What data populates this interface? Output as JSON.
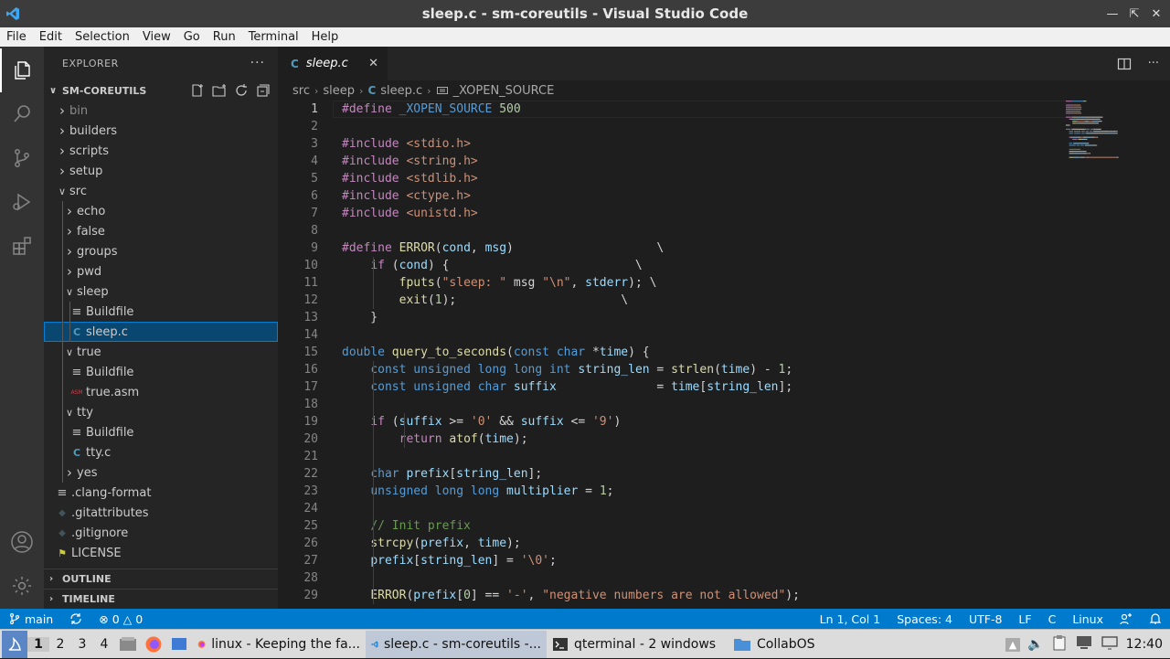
{
  "window": {
    "title": "sleep.c - sm-coreutils - Visual Studio Code"
  },
  "menu": [
    "File",
    "Edit",
    "Selection",
    "View",
    "Go",
    "Run",
    "Terminal",
    "Help"
  ],
  "explorer": {
    "header": "EXPLORER",
    "workspace": "SM-COREUTILS",
    "items": [
      {
        "label": "bin",
        "kind": "folder",
        "open": false,
        "depth": 0,
        "dim": true
      },
      {
        "label": "builders",
        "kind": "folder",
        "open": false,
        "depth": 0
      },
      {
        "label": "scripts",
        "kind": "folder",
        "open": false,
        "depth": 0
      },
      {
        "label": "setup",
        "kind": "folder",
        "open": false,
        "depth": 0
      },
      {
        "label": "src",
        "kind": "folder",
        "open": true,
        "depth": 0
      },
      {
        "label": "echo",
        "kind": "folder",
        "open": false,
        "depth": 1
      },
      {
        "label": "false",
        "kind": "folder",
        "open": false,
        "depth": 1
      },
      {
        "label": "groups",
        "kind": "folder",
        "open": false,
        "depth": 1
      },
      {
        "label": "pwd",
        "kind": "folder",
        "open": false,
        "depth": 1
      },
      {
        "label": "sleep",
        "kind": "folder",
        "open": true,
        "depth": 1
      },
      {
        "label": "Buildfile",
        "kind": "build",
        "depth": 2
      },
      {
        "label": "sleep.c",
        "kind": "c",
        "depth": 2,
        "selected": true
      },
      {
        "label": "true",
        "kind": "folder",
        "open": true,
        "depth": 1
      },
      {
        "label": "Buildfile",
        "kind": "build",
        "depth": 2
      },
      {
        "label": "true.asm",
        "kind": "asm",
        "depth": 2
      },
      {
        "label": "tty",
        "kind": "folder",
        "open": true,
        "depth": 1
      },
      {
        "label": "Buildfile",
        "kind": "build",
        "depth": 2
      },
      {
        "label": "tty.c",
        "kind": "c",
        "depth": 2
      },
      {
        "label": "yes",
        "kind": "folder",
        "open": false,
        "depth": 1
      },
      {
        "label": ".clang-format",
        "kind": "build",
        "depth": 0
      },
      {
        "label": ".gitattributes",
        "kind": "git",
        "depth": 0
      },
      {
        "label": ".gitignore",
        "kind": "git",
        "depth": 0
      },
      {
        "label": "LICENSE",
        "kind": "license",
        "depth": 0
      }
    ],
    "outline": "OUTLINE",
    "timeline": "TIMELINE"
  },
  "editor": {
    "tab": "sleep.c",
    "tab_icon": "C",
    "breadcrumb": [
      "src",
      "sleep",
      "sleep.c",
      "_XOPEN_SOURCE"
    ],
    "current_line": 1,
    "lines": [
      [
        [
          "#define ",
          "#c586c0"
        ],
        [
          "_XOPEN_SOURCE",
          "#569cd6"
        ],
        [
          " 500",
          "#b5cea8"
        ]
      ],
      [],
      [
        [
          "#include ",
          "#c586c0"
        ],
        [
          "<stdio.h>",
          "#ce9178"
        ]
      ],
      [
        [
          "#include ",
          "#c586c0"
        ],
        [
          "<string.h>",
          "#ce9178"
        ]
      ],
      [
        [
          "#include ",
          "#c586c0"
        ],
        [
          "<stdlib.h>",
          "#ce9178"
        ]
      ],
      [
        [
          "#include ",
          "#c586c0"
        ],
        [
          "<ctype.h>",
          "#ce9178"
        ]
      ],
      [
        [
          "#include ",
          "#c586c0"
        ],
        [
          "<unistd.h>",
          "#ce9178"
        ]
      ],
      [],
      [
        [
          "#define ",
          "#c586c0"
        ],
        [
          "ERROR",
          "#dcdcaa"
        ],
        [
          "(",
          "#d4d4d4"
        ],
        [
          "cond",
          "#9cdcfe"
        ],
        [
          ", ",
          "#d4d4d4"
        ],
        [
          "msg",
          "#9cdcfe"
        ],
        [
          ")                    \\",
          "#d4d4d4"
        ]
      ],
      [
        [
          "    ",
          "#d4d4d4"
        ],
        [
          "if",
          "#c586c0"
        ],
        [
          " (",
          "#d4d4d4"
        ],
        [
          "cond",
          "#9cdcfe"
        ],
        [
          ") {",
          "#d4d4d4"
        ],
        [
          "                          \\",
          "#d4d4d4"
        ]
      ],
      [
        [
          "        ",
          "#d4d4d4"
        ],
        [
          "fputs",
          "#dcdcaa"
        ],
        [
          "(",
          "#d4d4d4"
        ],
        [
          "\"sleep: \"",
          "#ce9178"
        ],
        [
          " msg ",
          "#d4d4d4"
        ],
        [
          "\"\\n\"",
          "#ce9178"
        ],
        [
          ", ",
          "#d4d4d4"
        ],
        [
          "stderr",
          "#9cdcfe"
        ],
        [
          "); \\",
          "#d4d4d4"
        ]
      ],
      [
        [
          "        ",
          "#d4d4d4"
        ],
        [
          "exit",
          "#dcdcaa"
        ],
        [
          "(",
          "#d4d4d4"
        ],
        [
          "1",
          "#b5cea8"
        ],
        [
          ");",
          "#d4d4d4"
        ],
        [
          "                       \\",
          "#d4d4d4"
        ]
      ],
      [
        [
          "    }",
          "#d4d4d4"
        ]
      ],
      [],
      [
        [
          "double",
          "#569cd6"
        ],
        [
          " ",
          "#d4d4d4"
        ],
        [
          "query_to_seconds",
          "#dcdcaa"
        ],
        [
          "(",
          "#d4d4d4"
        ],
        [
          "const",
          "#569cd6"
        ],
        [
          " ",
          "#d4d4d4"
        ],
        [
          "char",
          "#569cd6"
        ],
        [
          " *",
          "#d4d4d4"
        ],
        [
          "time",
          "#9cdcfe"
        ],
        [
          ") {",
          "#d4d4d4"
        ]
      ],
      [
        [
          "    ",
          "#d4d4d4"
        ],
        [
          "const",
          "#569cd6"
        ],
        [
          " ",
          "#d4d4d4"
        ],
        [
          "unsigned",
          "#569cd6"
        ],
        [
          " ",
          "#d4d4d4"
        ],
        [
          "long",
          "#569cd6"
        ],
        [
          " ",
          "#d4d4d4"
        ],
        [
          "long",
          "#569cd6"
        ],
        [
          " ",
          "#d4d4d4"
        ],
        [
          "int",
          "#569cd6"
        ],
        [
          " ",
          "#d4d4d4"
        ],
        [
          "string_len",
          "#9cdcfe"
        ],
        [
          " = ",
          "#d4d4d4"
        ],
        [
          "strlen",
          "#dcdcaa"
        ],
        [
          "(",
          "#d4d4d4"
        ],
        [
          "time",
          "#9cdcfe"
        ],
        [
          ") - ",
          "#d4d4d4"
        ],
        [
          "1",
          "#b5cea8"
        ],
        [
          ";",
          "#d4d4d4"
        ]
      ],
      [
        [
          "    ",
          "#d4d4d4"
        ],
        [
          "const",
          "#569cd6"
        ],
        [
          " ",
          "#d4d4d4"
        ],
        [
          "unsigned",
          "#569cd6"
        ],
        [
          " ",
          "#d4d4d4"
        ],
        [
          "char",
          "#569cd6"
        ],
        [
          " ",
          "#d4d4d4"
        ],
        [
          "suffix",
          "#9cdcfe"
        ],
        [
          "              = ",
          "#d4d4d4"
        ],
        [
          "time",
          "#9cdcfe"
        ],
        [
          "[",
          "#d4d4d4"
        ],
        [
          "string_len",
          "#9cdcfe"
        ],
        [
          "];",
          "#d4d4d4"
        ]
      ],
      [],
      [
        [
          "    ",
          "#d4d4d4"
        ],
        [
          "if",
          "#c586c0"
        ],
        [
          " (",
          "#d4d4d4"
        ],
        [
          "suffix",
          "#9cdcfe"
        ],
        [
          " >= ",
          "#d4d4d4"
        ],
        [
          "'0'",
          "#ce9178"
        ],
        [
          " && ",
          "#d4d4d4"
        ],
        [
          "suffix",
          "#9cdcfe"
        ],
        [
          " <= ",
          "#d4d4d4"
        ],
        [
          "'9'",
          "#ce9178"
        ],
        [
          ")",
          "#d4d4d4"
        ]
      ],
      [
        [
          "        ",
          "#d4d4d4"
        ],
        [
          "return",
          "#c586c0"
        ],
        [
          " ",
          "#d4d4d4"
        ],
        [
          "atof",
          "#dcdcaa"
        ],
        [
          "(",
          "#d4d4d4"
        ],
        [
          "time",
          "#9cdcfe"
        ],
        [
          ");",
          "#d4d4d4"
        ]
      ],
      [],
      [
        [
          "    ",
          "#d4d4d4"
        ],
        [
          "char",
          "#569cd6"
        ],
        [
          " ",
          "#d4d4d4"
        ],
        [
          "prefix",
          "#9cdcfe"
        ],
        [
          "[",
          "#d4d4d4"
        ],
        [
          "string_len",
          "#9cdcfe"
        ],
        [
          "];",
          "#d4d4d4"
        ]
      ],
      [
        [
          "    ",
          "#d4d4d4"
        ],
        [
          "unsigned",
          "#569cd6"
        ],
        [
          " ",
          "#d4d4d4"
        ],
        [
          "long",
          "#569cd6"
        ],
        [
          " ",
          "#d4d4d4"
        ],
        [
          "long",
          "#569cd6"
        ],
        [
          " ",
          "#d4d4d4"
        ],
        [
          "multiplier",
          "#9cdcfe"
        ],
        [
          " = ",
          "#d4d4d4"
        ],
        [
          "1",
          "#b5cea8"
        ],
        [
          ";",
          "#d4d4d4"
        ]
      ],
      [],
      [
        [
          "    ",
          "#d4d4d4"
        ],
        [
          "// Init prefix",
          "#6a9955"
        ]
      ],
      [
        [
          "    ",
          "#d4d4d4"
        ],
        [
          "strcpy",
          "#dcdcaa"
        ],
        [
          "(",
          "#d4d4d4"
        ],
        [
          "prefix",
          "#9cdcfe"
        ],
        [
          ", ",
          "#d4d4d4"
        ],
        [
          "time",
          "#9cdcfe"
        ],
        [
          ");",
          "#d4d4d4"
        ]
      ],
      [
        [
          "    ",
          "#d4d4d4"
        ],
        [
          "prefix",
          "#9cdcfe"
        ],
        [
          "[",
          "#d4d4d4"
        ],
        [
          "string_len",
          "#9cdcfe"
        ],
        [
          "] = ",
          "#d4d4d4"
        ],
        [
          "'\\0'",
          "#ce9178"
        ],
        [
          ";",
          "#d4d4d4"
        ]
      ],
      [],
      [
        [
          "    ",
          "#d4d4d4"
        ],
        [
          "ERROR",
          "#dcdcaa"
        ],
        [
          "(",
          "#d4d4d4"
        ],
        [
          "prefix",
          "#9cdcfe"
        ],
        [
          "[",
          "#d4d4d4"
        ],
        [
          "0",
          "#b5cea8"
        ],
        [
          "] == ",
          "#d4d4d4"
        ],
        [
          "'-'",
          "#ce9178"
        ],
        [
          ", ",
          "#d4d4d4"
        ],
        [
          "\"negative numbers are not allowed\"",
          "#ce9178"
        ],
        [
          ");",
          "#d4d4d4"
        ]
      ]
    ]
  },
  "status": {
    "branch": "main",
    "errors": "0",
    "warnings": "0",
    "position": "Ln 1, Col 1",
    "spaces": "Spaces: 4",
    "encoding": "UTF-8",
    "eol": "LF",
    "language": "C",
    "platform": "Linux"
  },
  "taskbar": {
    "workspaces": [
      "1",
      "2",
      "3",
      "4"
    ],
    "tasks": [
      {
        "label": "linux - Keeping the fa...",
        "icon": "firefox-icon",
        "active": false
      },
      {
        "label": "sleep.c - sm-coreutils -...",
        "icon": "vscode-icon",
        "active": true
      },
      {
        "label": "qterminal - 2 windows",
        "icon": "terminal-icon",
        "active": false
      },
      {
        "label": "CollabOS",
        "icon": "folder-icon",
        "active": false
      }
    ],
    "clock": "12:40"
  },
  "colors": {
    "accent": "#007acc",
    "selection": "#094771",
    "activity": "#333333",
    "sidebar": "#252526",
    "editor": "#1e1e1e"
  }
}
